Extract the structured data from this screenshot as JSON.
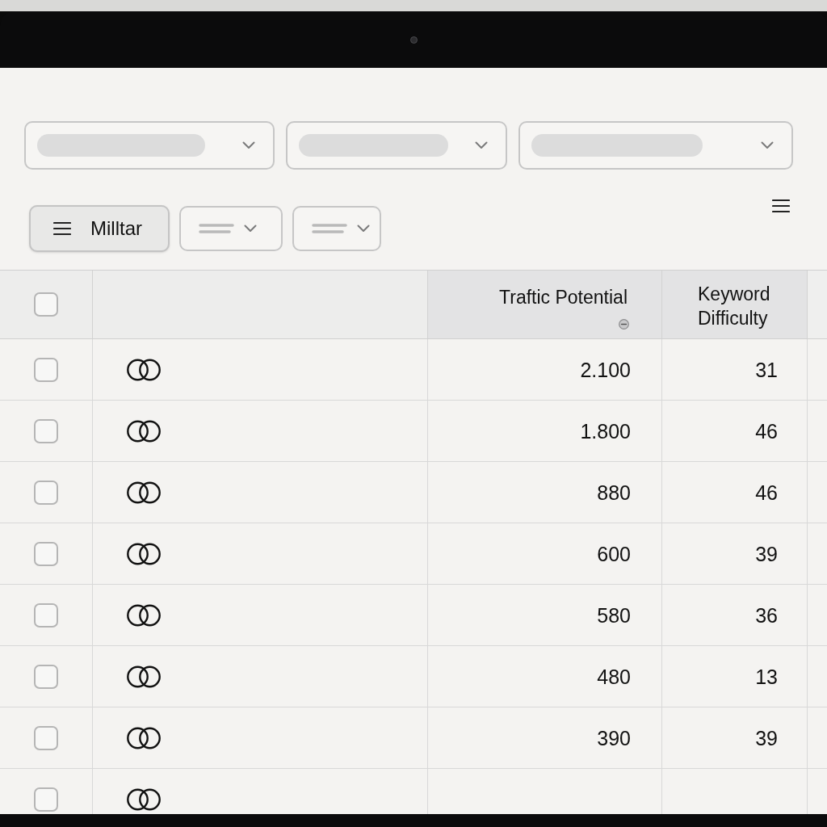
{
  "filter_dropdowns": [
    {
      "blurred": true
    },
    {
      "blurred": true
    },
    {
      "blurred": true
    }
  ],
  "toolbar": {
    "filter_button": {
      "label": "Milltar"
    },
    "view_dropdowns": [
      {
        "blurred": true
      },
      {
        "blurred": true
      }
    ]
  },
  "table": {
    "header_checkbox": {
      "checked": false
    },
    "columns": [
      {
        "label": "Traftic Potential",
        "sorted": true
      },
      {
        "label": "Keyword Difficulty",
        "sorted": false
      }
    ],
    "rows": [
      {
        "checked": false,
        "traffic_potential": "2.100",
        "keyword_difficulty": "31"
      },
      {
        "checked": false,
        "traffic_potential": "1.800",
        "keyword_difficulty": "46"
      },
      {
        "checked": false,
        "traffic_potential": "880",
        "keyword_difficulty": "46"
      },
      {
        "checked": false,
        "traffic_potential": "600",
        "keyword_difficulty": "39"
      },
      {
        "checked": false,
        "traffic_potential": "580",
        "keyword_difficulty": "36"
      },
      {
        "checked": false,
        "traffic_potential": "480",
        "keyword_difficulty": "13"
      },
      {
        "checked": false,
        "traffic_potential": "390",
        "keyword_difficulty": "39"
      },
      {
        "checked": false
      }
    ]
  }
}
